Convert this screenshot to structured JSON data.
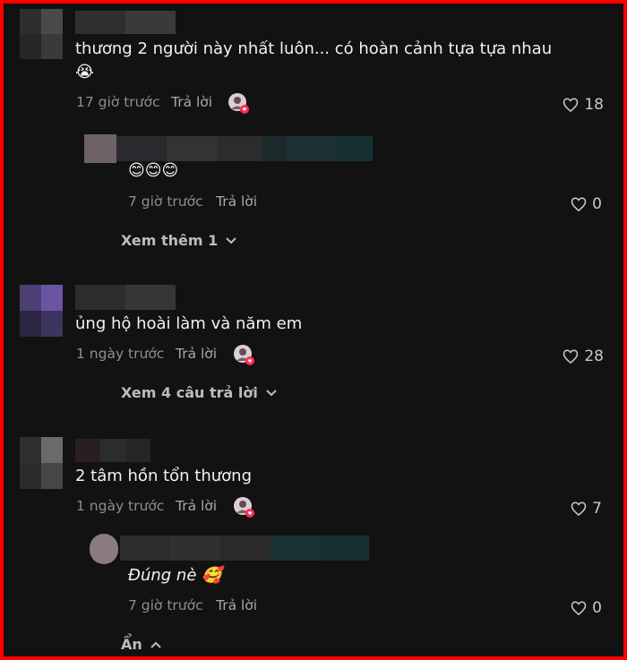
{
  "comments": [
    {
      "text_line1": "thương 2 người này nhất luôn... có hoàn cảnh tựa tựa nhau",
      "text_line2": "😭",
      "time": "17 giờ trước",
      "reply": "Trả lời",
      "likes": "18"
    },
    {
      "text": "😊😊😊",
      "time": "7 giờ trước",
      "reply": "Trả lời",
      "likes": "0"
    },
    {
      "more": "Xem thêm 1"
    },
    {
      "text": "ủng hộ hoài làm và năm em",
      "time": "1 ngày trước",
      "reply": "Trả lời",
      "likes": "28"
    },
    {
      "more": "Xem 4 câu trả lời"
    },
    {
      "text": "2 tâm hồn tổn thương",
      "time": "1 ngày trước",
      "reply": "Trả lời",
      "likes": "7"
    },
    {
      "text": "Đúng nè 🥰",
      "time": "7 giờ trước",
      "reply": "Trả lời",
      "likes": "0"
    },
    {
      "more": "Ẩn"
    }
  ]
}
